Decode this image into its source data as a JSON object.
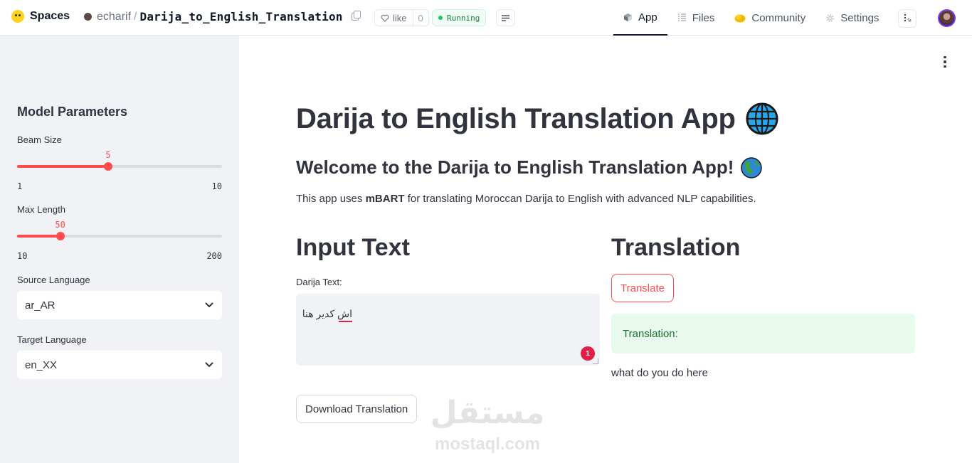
{
  "header": {
    "brand": "Spaces",
    "owner": "echarif",
    "separator": "/",
    "repo_name": "Darija_to_English_Translation",
    "like_label": "like",
    "like_count": "0",
    "status": "Running",
    "nav": [
      {
        "label": "App",
        "icon": "cube-icon",
        "active": true
      },
      {
        "label": "Files",
        "icon": "files-icon",
        "active": false
      },
      {
        "label": "Community",
        "icon": "community-icon",
        "active": false
      },
      {
        "label": "Settings",
        "icon": "gear-icon",
        "active": false
      }
    ]
  },
  "sidebar": {
    "title": "Model Parameters",
    "beam": {
      "label": "Beam Size",
      "value": 5,
      "value_text": "5",
      "min": 1,
      "max": 10,
      "min_text": "1",
      "max_text": "10"
    },
    "max_length": {
      "label": "Max Length",
      "value": 50,
      "value_text": "50",
      "min": 10,
      "max": 200,
      "min_text": "10",
      "max_text": "200"
    },
    "source": {
      "label": "Source Language",
      "value": "ar_AR"
    },
    "target": {
      "label": "Target Language",
      "value": "en_XX"
    }
  },
  "main": {
    "title": "Darija to English Translation App",
    "subtitle": "Welcome to the Darija to English Translation App!",
    "desc_prefix": "This app uses ",
    "desc_bold": "mBART",
    "desc_suffix": " for translating Moroccan Darija to English with advanced NLP capabilities.",
    "input_heading": "Input Text",
    "input_label": "Darija Text:",
    "input_value": "اش كدير هنا",
    "input_badge": "1",
    "download_label": "Download Translation",
    "translation_heading": "Translation",
    "translate_label": "Translate",
    "success_label": "Translation:",
    "result": "what do you do here"
  },
  "watermark": {
    "arabic": "مستقل",
    "latin": "mostaql.com"
  },
  "colors": {
    "accent": "#ff4b4b",
    "sidebar_bg": "#f0f2f6",
    "success_bg": "#e8f9ee",
    "success_text": "#177233",
    "badge": "#e11d48"
  }
}
